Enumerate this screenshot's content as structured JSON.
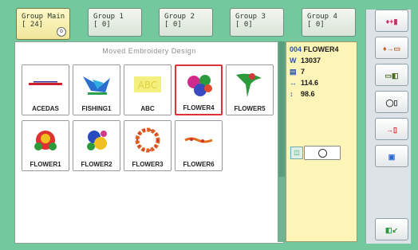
{
  "tabs": [
    {
      "line1": "Group Main",
      "line2": "[ 24]",
      "badge": "o",
      "active": true
    },
    {
      "line1": "Group 1",
      "line2": "[  0]"
    },
    {
      "line1": "Group 2",
      "line2": "[  0]"
    },
    {
      "line1": "Group 3",
      "line2": "[  0]"
    },
    {
      "line1": "Group 4",
      "line2": "[  0]"
    }
  ],
  "panel": {
    "title": "Moved Embroidery Design"
  },
  "designs": [
    {
      "name": "ACEDAS"
    },
    {
      "name": "FISHING1"
    },
    {
      "name": "ABC"
    },
    {
      "name": "FLOWER4"
    },
    {
      "name": "FLOWER5"
    },
    {
      "name": "FLOWER1"
    },
    {
      "name": "FLOWER2"
    },
    {
      "name": "FLOWER3"
    },
    {
      "name": "FLOWER6"
    }
  ],
  "info": {
    "code": "004",
    "name": "FLOWER4",
    "stitches": "13037",
    "colors": "7",
    "width": "114.6",
    "height": "98.6"
  },
  "right_buttons": [
    {
      "icon": "add-to-group-icon"
    },
    {
      "icon": "move-icon"
    },
    {
      "icon": "card-icon"
    },
    {
      "icon": "usb-icon"
    },
    {
      "icon": "delete-icon"
    },
    {
      "icon": "palette-icon"
    },
    {
      "icon": "ok-icon"
    }
  ]
}
